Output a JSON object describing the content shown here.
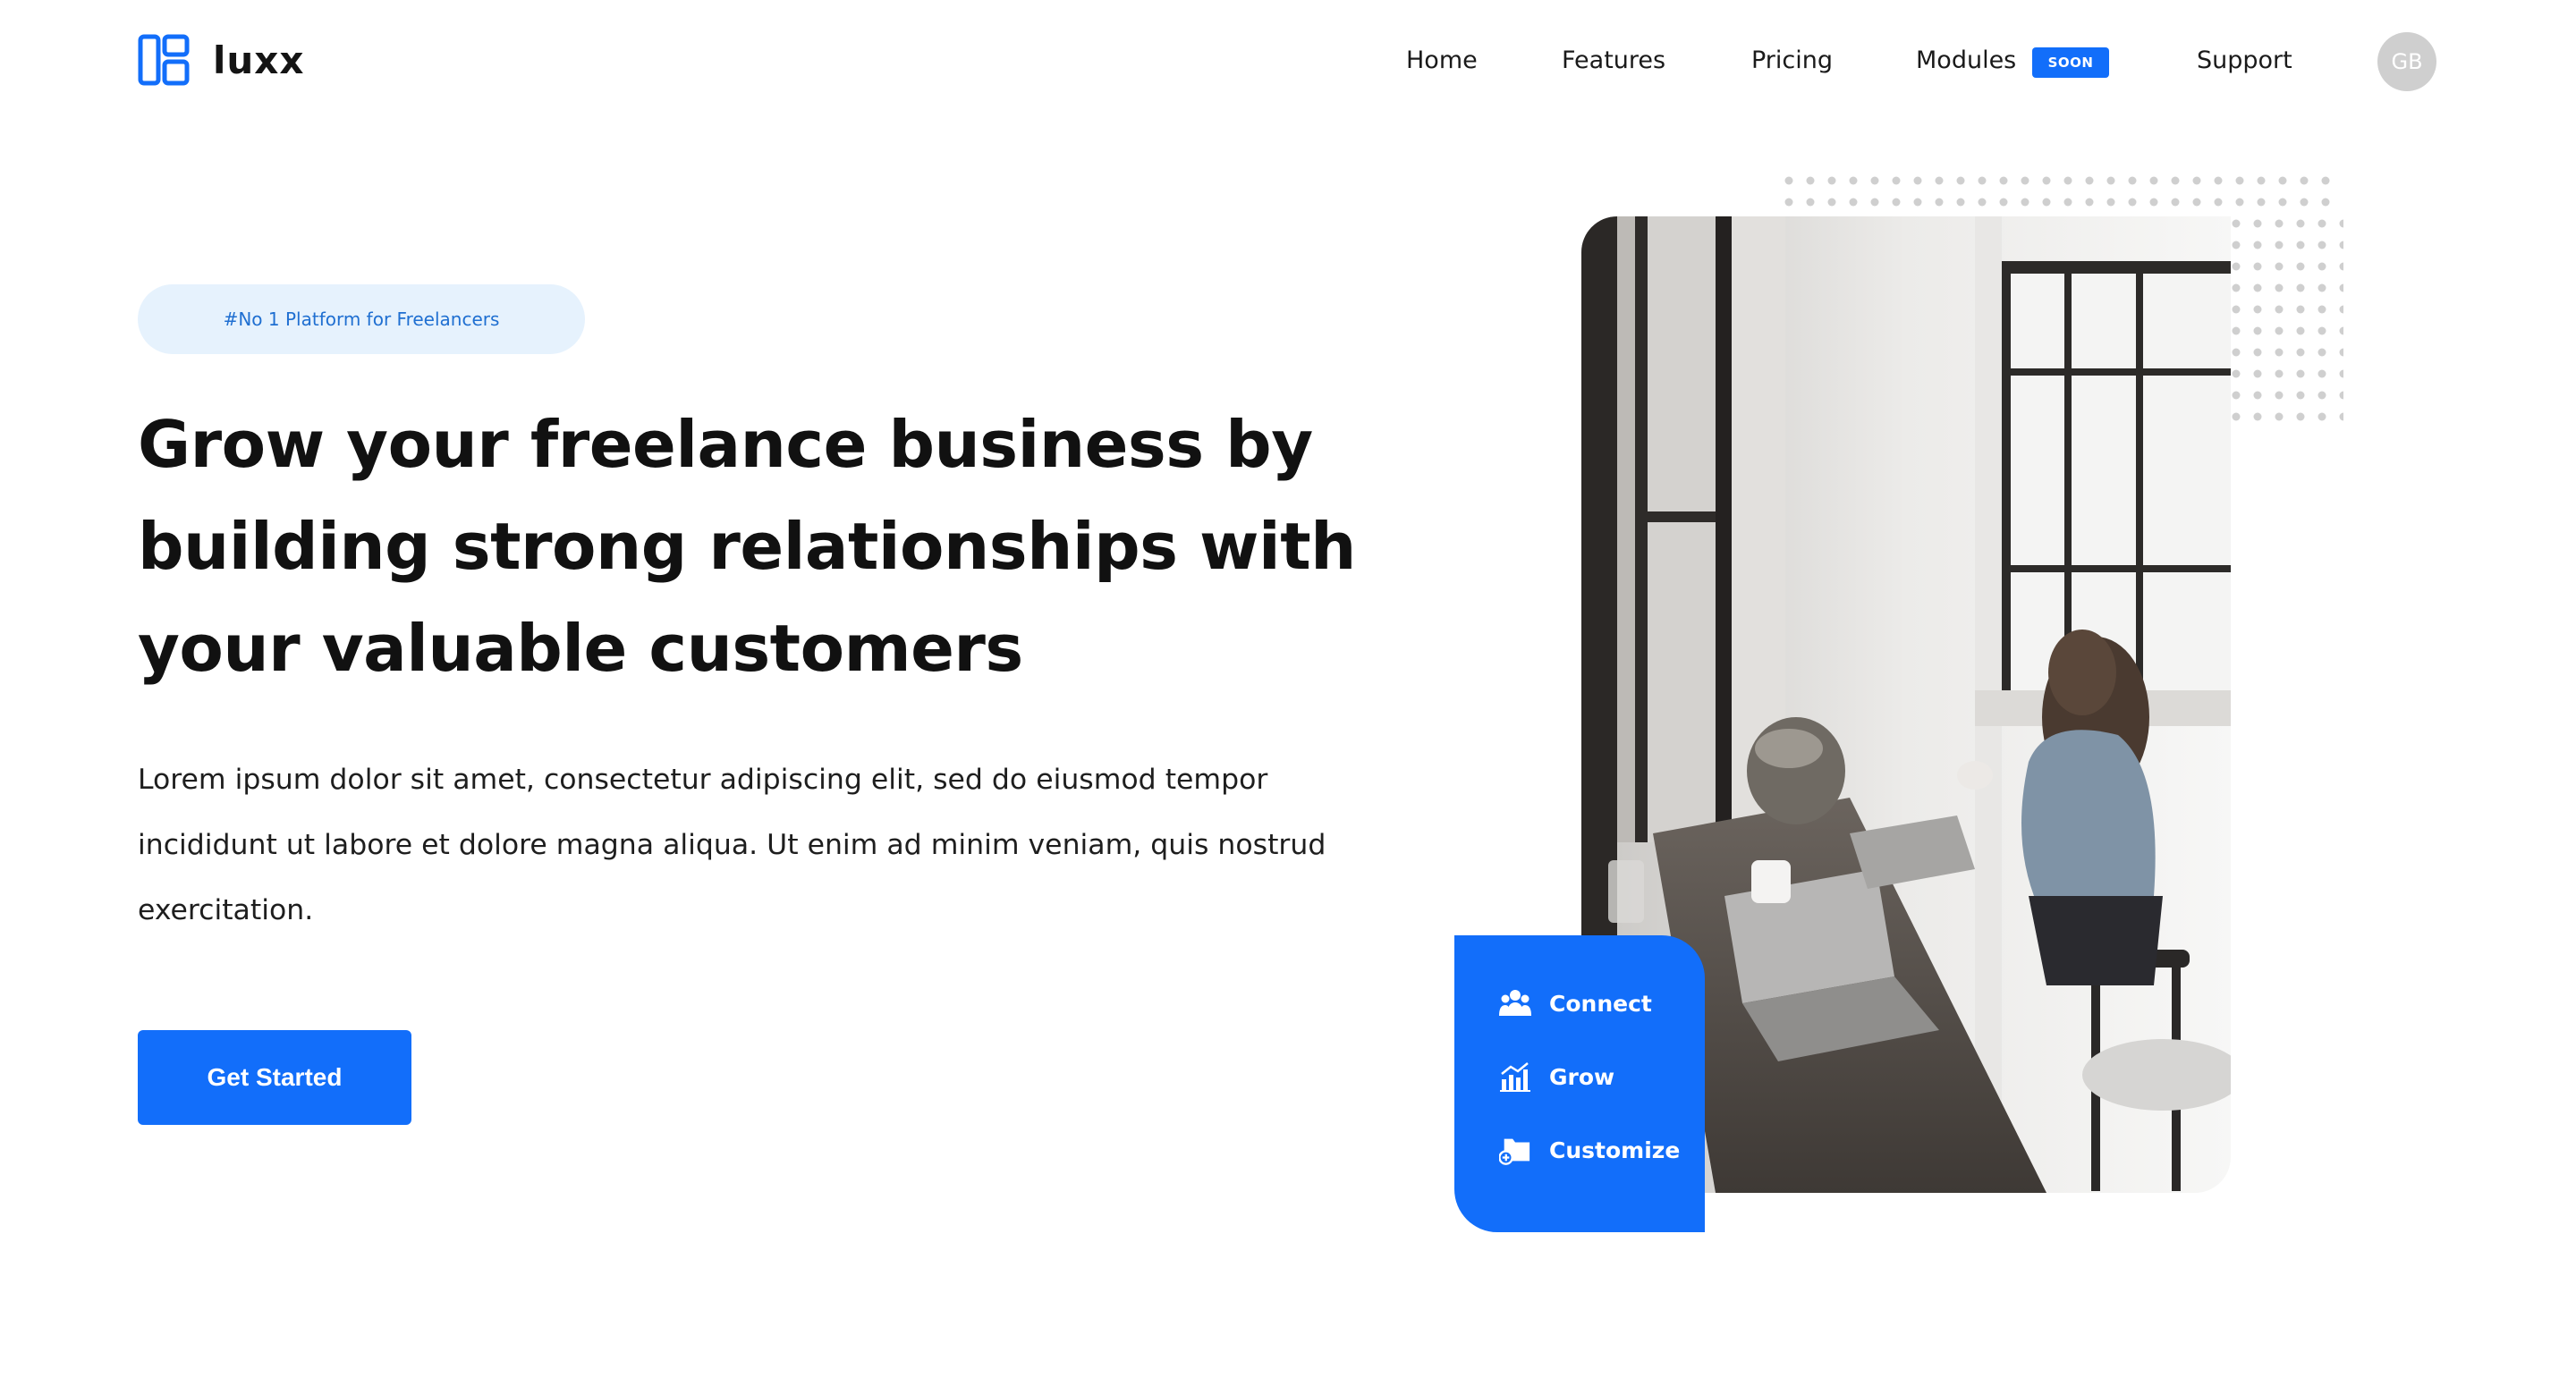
{
  "brand": {
    "name": "luxx",
    "accent": "#126efa"
  },
  "nav": {
    "items": [
      {
        "label": "Home"
      },
      {
        "label": "Features"
      },
      {
        "label": "Pricing"
      },
      {
        "label": "Modules"
      },
      {
        "label": "Support"
      }
    ],
    "modules_badge": "SOON",
    "avatar_initials": "GB"
  },
  "hero": {
    "tag": "#No 1 Platform for Freelancers",
    "headline": "Grow your freelance business by building strong relationships with your valuable customers",
    "description": "Lorem ipsum dolor sit amet, consectetur adipiscing elit, sed do eiusmod tempor incididunt ut labore et dolore magna aliqua. Ut enim ad minim veniam, quis nostrud exercitation.",
    "cta_label": "Get Started"
  },
  "features": [
    {
      "label": "Connect",
      "icon": "users-icon"
    },
    {
      "label": "Grow",
      "icon": "chart-icon"
    },
    {
      "label": "Customize",
      "icon": "folder-add-icon"
    }
  ],
  "colors": {
    "accent": "#126efa",
    "tag_bg": "#e6f2fd",
    "tag_text": "#1f6fd1",
    "avatar_bg": "#cfcfcf"
  }
}
